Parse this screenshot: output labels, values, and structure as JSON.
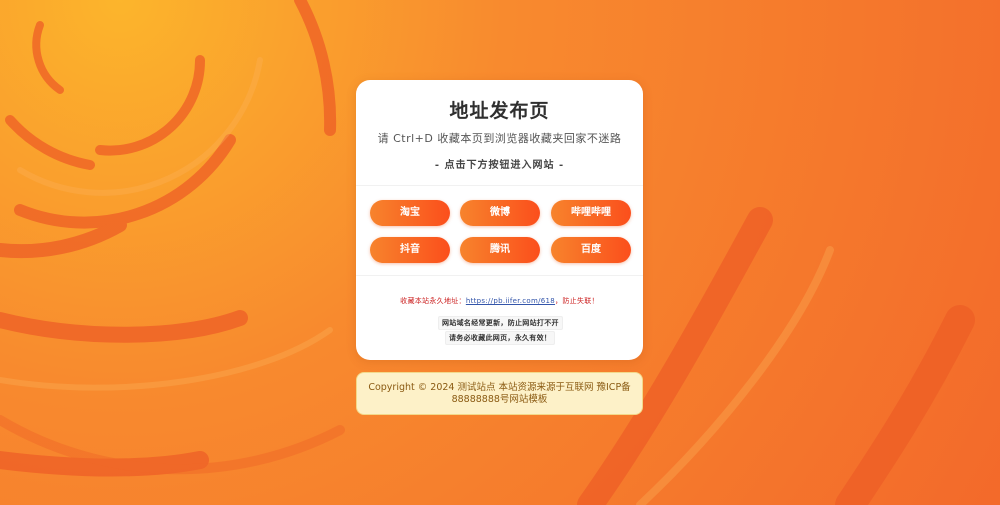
{
  "page": {
    "title": "地址发布页",
    "subtitle": "请 Ctrl+D 收藏本页到浏览器收藏夹回家不迷路",
    "hint": "- 点击下方按钮进入网站 -"
  },
  "buttons": [
    {
      "label": "淘宝"
    },
    {
      "label": "微博"
    },
    {
      "label": "哔哩哔哩"
    },
    {
      "label": "抖音"
    },
    {
      "label": "腾讯"
    },
    {
      "label": "百度"
    }
  ],
  "notice": {
    "prefix": "收藏本站永久地址：",
    "link": "https://pb.iifer.com/618",
    "suffix": "，防止失联！"
  },
  "tags": {
    "line1": "网站域名经常更新，防止网站打不开",
    "line2": "请务必收藏此网页，永久有效！"
  },
  "footer": {
    "line1": "Copyright © 2024 测试站点 本站资源来源于互联网 豫ICP备",
    "line2": "88888888号网站模板"
  },
  "colors": {
    "background": "#f6782c",
    "button_start": "#f7832c",
    "button_end": "#fb4f1c",
    "footer_bg": "#fdf1c8",
    "footer_text": "#8a5a12",
    "notice": "#cc2222"
  }
}
